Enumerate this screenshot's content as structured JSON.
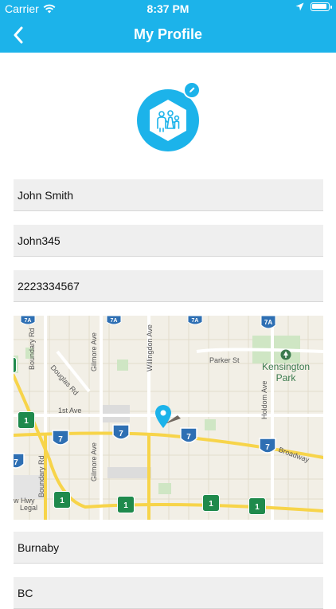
{
  "status_bar": {
    "carrier": "Carrier",
    "time": "8:37 PM"
  },
  "header": {
    "title": "My Profile"
  },
  "profile": {
    "full_name": "John Smith",
    "username": "John345",
    "phone": "2223334567",
    "city": "Burnaby",
    "province": "BC"
  },
  "map": {
    "streets": [
      "Boundary Rd",
      "Douglas Rd",
      "Gilmore Ave",
      "Willingdon Ave",
      "Parker St",
      "Holdom Ave",
      "1st Ave",
      "Broadway",
      "Gilmore Ave",
      "Boundary Rd",
      "Legal",
      "w Hwy"
    ],
    "park": [
      "Kensington",
      "Park"
    ],
    "highway_shields": [
      "7A",
      "7A",
      "7A",
      "7A",
      "7",
      "7",
      "7",
      "7",
      "7",
      "1",
      "1",
      "1",
      "1",
      "1",
      "1"
    ]
  }
}
